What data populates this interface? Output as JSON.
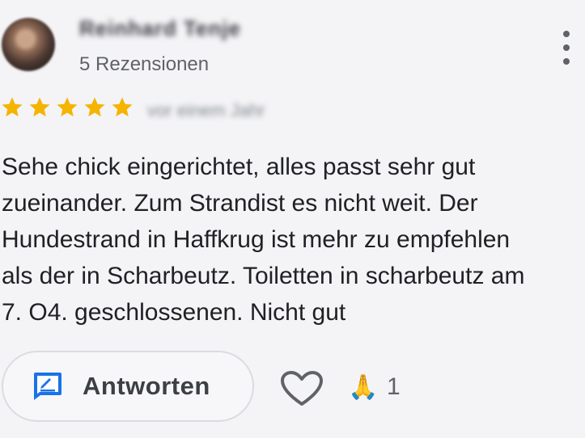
{
  "review": {
    "author_name": "Reinhard Tenje",
    "reviews_count": "5 Rezensionen",
    "rating": 5,
    "date": "vor einem Jahr",
    "text": "Sehe chick eingerichtet, alles passt sehr gut\nzueinander. Zum Strandist es nicht weit. Der\nHundestrand in Haffkrug ist mehr zu empfehlen\nals der in Scharbeutz. Toiletten in scharbeutz am\n7. O4. geschlossenen. Nicht gut"
  },
  "actions": {
    "reply_label": "Antworten",
    "reaction_emoji": "🙏",
    "reaction_count": "1"
  },
  "icons": {
    "star": "star-icon",
    "more": "more-vert-icon",
    "reply": "reply-icon",
    "like": "heart-icon"
  },
  "colors": {
    "star": "#f5b400",
    "accent_blue": "#1a73e8",
    "text_secondary": "#5f6368"
  }
}
